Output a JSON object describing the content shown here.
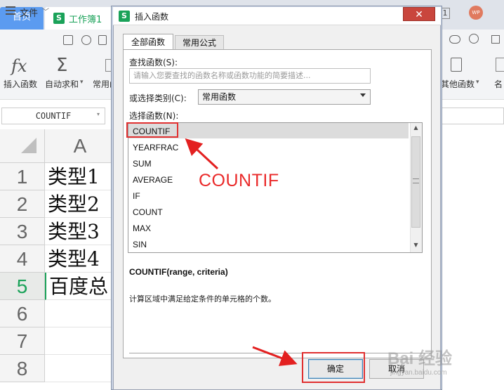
{
  "app": {
    "tab_home": "首页",
    "doc_icon": "S",
    "doc_tab": "工作簿1",
    "page_count": "1",
    "avatar": "WP"
  },
  "menu": {
    "file": "文件",
    "file_caret": "﹀"
  },
  "ribbon": {
    "insert_function_icon": "fx",
    "insert_function": "插入函数",
    "autosum_icon": "Σ",
    "autosum": "自动求和",
    "autosum_caret": "▾",
    "common": "常用函",
    "other_functions": "其他函数",
    "other_caret": "▾",
    "right_cut": "名"
  },
  "formula_bar": {
    "name_box": "COUNTIF",
    "name_caret": "▾"
  },
  "sheet": {
    "column_header": "A",
    "rows": [
      {
        "num": "1",
        "value": "类型1"
      },
      {
        "num": "2",
        "value": "类型2"
      },
      {
        "num": "3",
        "value": "类型3"
      },
      {
        "num": "4",
        "value": "类型4"
      },
      {
        "num": "5",
        "value": "百度总"
      },
      {
        "num": "6",
        "value": ""
      },
      {
        "num": "7",
        "value": ""
      },
      {
        "num": "8",
        "value": ""
      }
    ],
    "active_row": "5"
  },
  "dialog": {
    "icon": "S",
    "title": "插入函数",
    "close": "✕",
    "tabs": [
      "全部函数",
      "常用公式"
    ],
    "search_label": "查找函数(S):",
    "search_placeholder": "请输入您要查找的函数名称或函数功能的简要描述...",
    "category_label": "或选择类别(C):",
    "category_value": "常用函数",
    "list_label": "选择函数(N):",
    "functions": [
      "COUNTIF",
      "YEARFRAC",
      "SUM",
      "AVERAGE",
      "IF",
      "COUNT",
      "MAX",
      "SIN"
    ],
    "selected_function": "COUNTIF",
    "signature": "COUNTIF(range, criteria)",
    "description": "计算区域中满足给定条件的单元格的个数。",
    "ok": "确定",
    "cancel": "取消",
    "scroll_up": "▲",
    "scroll_down": "▼"
  },
  "annotation": {
    "label": "COUNTIF",
    "color": "#ea2a2a"
  },
  "watermark": {
    "text": "Bai 经验",
    "url": "jingyan.baidu.com"
  },
  "colors": {
    "accent_green": "#1aa259",
    "home_tab_blue": "#5b9bf0",
    "close_red": "#c9463d",
    "highlight_red": "#e03030"
  }
}
